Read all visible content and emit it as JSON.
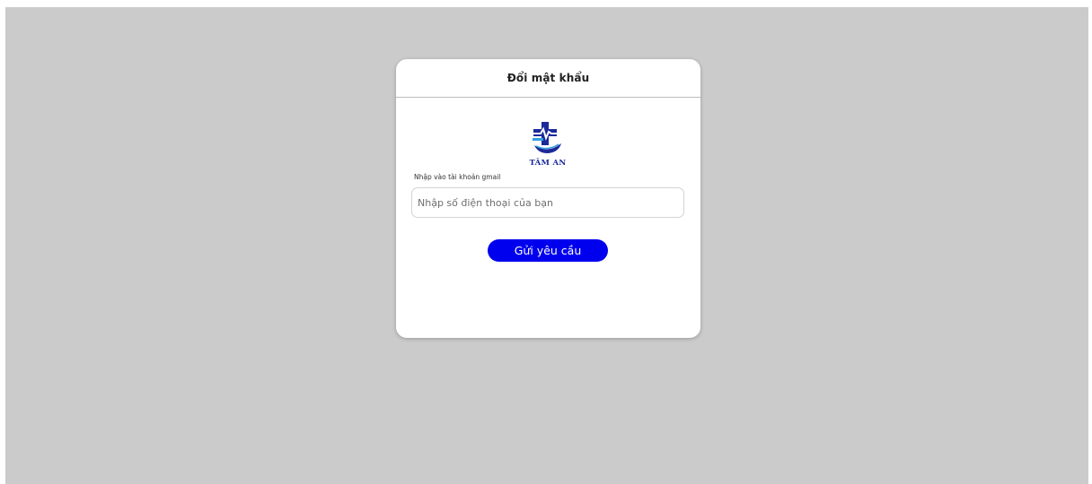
{
  "dialog": {
    "title": "Đổi mật khẩu"
  },
  "logo": {
    "icon": "medical-cross-hand-logo",
    "brand_name": "TÂM AN",
    "color": "#1b2a9a"
  },
  "form": {
    "email_label": "Nhập vào tài khoản gmail",
    "email_placeholder": "Nhập số điện thoại của bạn",
    "email_value": "",
    "submit_label": "Gửi yêu cầu"
  },
  "colors": {
    "backdrop": "#cbcbcb",
    "card": "#ffffff",
    "button": "#0000ee",
    "button_text": "#ffffff"
  }
}
